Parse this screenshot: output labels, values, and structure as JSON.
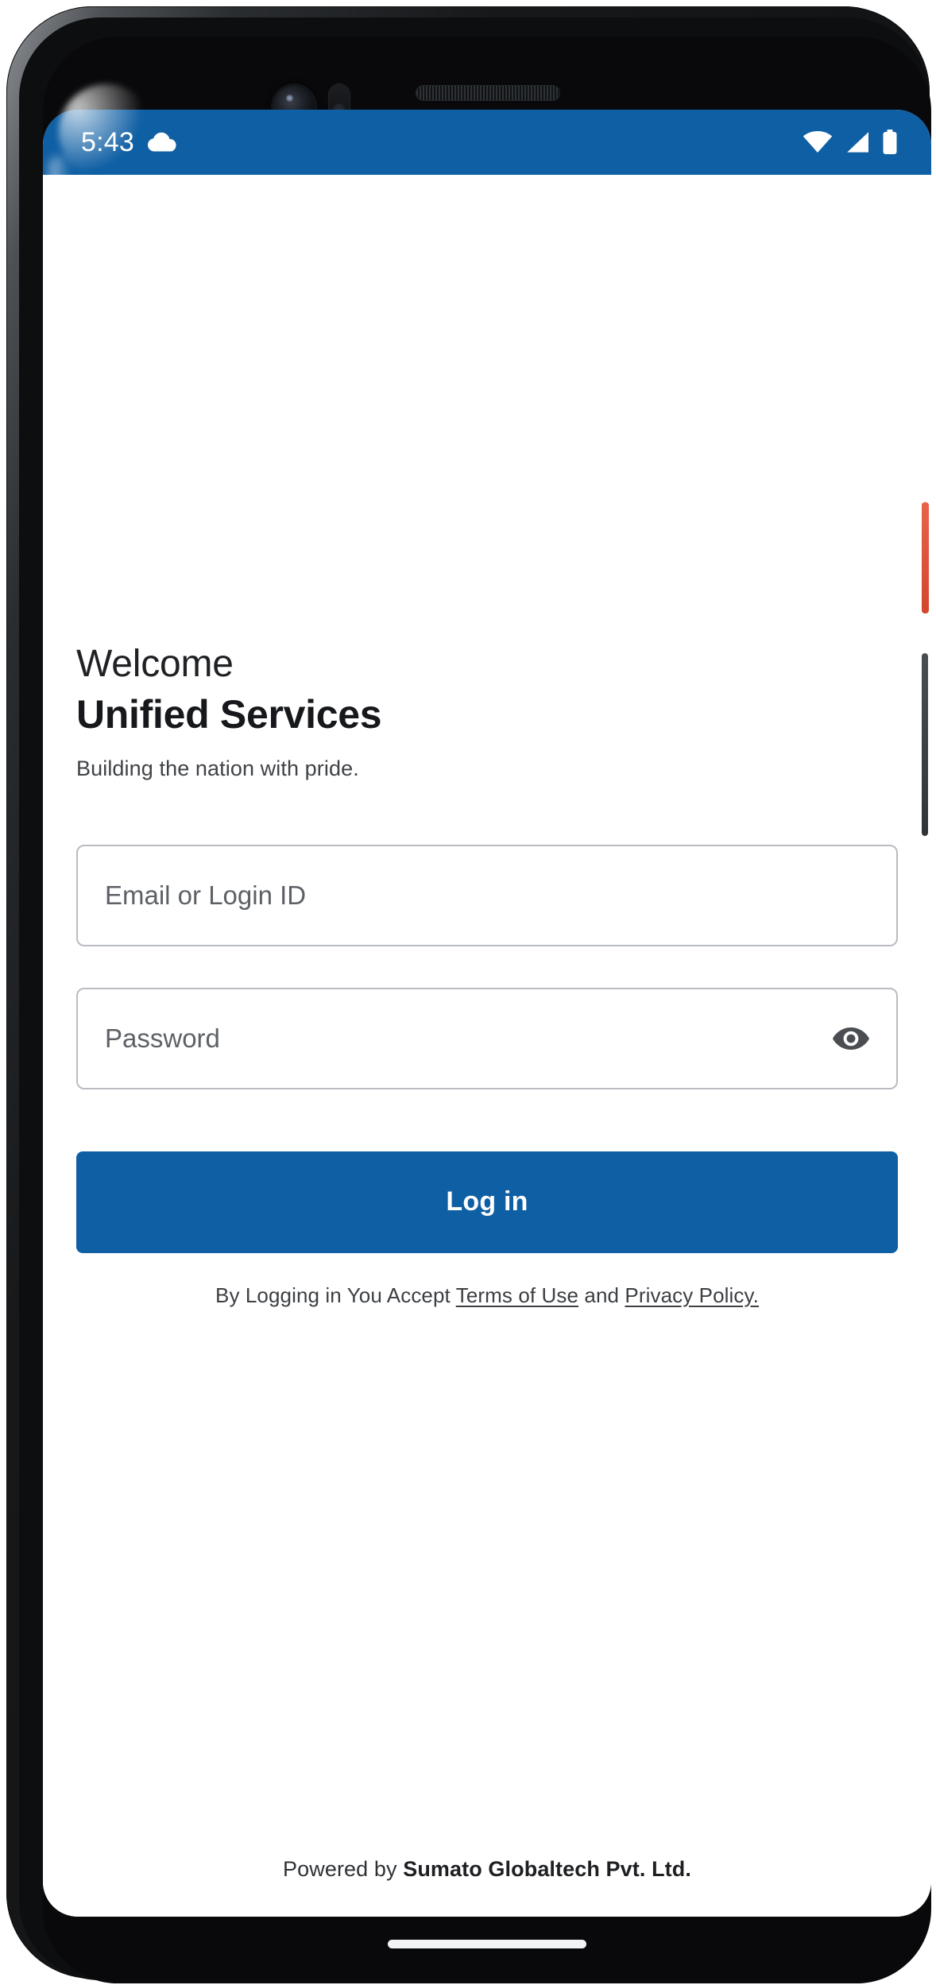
{
  "device": {
    "hardware": {
      "camera": "front-camera-lens",
      "sensor": "proximity-sensor",
      "speaker": "earpiece-speaker-grille",
      "power_button": "power-button",
      "volume_button": "volume-rocker"
    }
  },
  "status_bar": {
    "time": "5:43",
    "background_color": "#0f5fa4",
    "foreground_color": "#ffffff",
    "left_icons": [
      "cloud-icon"
    ],
    "right_icons": [
      "wifi-icon",
      "cellular-signal-icon",
      "battery-icon"
    ]
  },
  "screen": {
    "background_color": "#ffffff",
    "header": {
      "welcome": "Welcome",
      "brand": "Unified Services",
      "tagline": "Building the nation with pride."
    },
    "form": {
      "email": {
        "value": "",
        "placeholder": "Email or Login ID"
      },
      "password": {
        "value": "",
        "placeholder": "Password",
        "toggle_icon": "eye-icon"
      },
      "submit_label": "Log in",
      "submit_color": "#0f5fa4"
    },
    "terms": {
      "prefix": "By Logging in You Accept ",
      "terms_link": "Terms of Use",
      "conjunction": " and ",
      "privacy_link": "Privacy Policy."
    },
    "footer": {
      "prefix": "Powered by ",
      "brand": "Sumato Globaltech Pvt. Ltd."
    }
  }
}
